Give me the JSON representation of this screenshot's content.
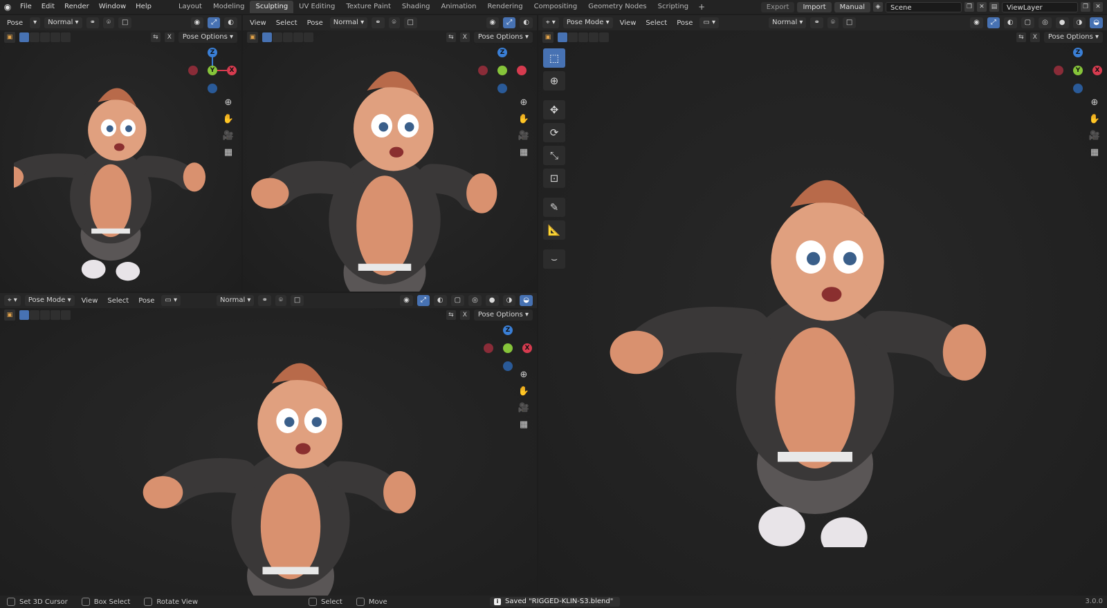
{
  "menu": [
    "File",
    "Edit",
    "Render",
    "Window",
    "Help"
  ],
  "workspaces": [
    "Layout",
    "Modeling",
    "Sculpting",
    "UV Editing",
    "Texture Paint",
    "Shading",
    "Animation",
    "Rendering",
    "Compositing",
    "Geometry Nodes",
    "Scripting"
  ],
  "active_workspace": "Sculpting",
  "top_right": {
    "export": "Export",
    "import": "Import",
    "manual": "Manual",
    "scene": "Scene",
    "view_layer": "ViewLayer"
  },
  "vp1": {
    "mode": "Pose",
    "orientation": "Normal",
    "options": "Pose Options"
  },
  "vp2": {
    "view": "View",
    "select": "Select",
    "pose": "Pose",
    "orientation": "Normal",
    "options": "Pose Options"
  },
  "vp3": {
    "mode": "Pose Mode",
    "view": "View",
    "select": "Select",
    "pose": "Pose",
    "orientation": "Normal",
    "options": "Pose Options"
  },
  "vp4": {
    "mode": "Pose Mode",
    "view": "View",
    "select": "Select",
    "pose": "Pose",
    "orientation": "Normal",
    "options": "Pose Options"
  },
  "gizmo": {
    "x": "X",
    "y": "Y",
    "z": "Z",
    "x_color": "#d63b4f",
    "y_color": "#86c43a",
    "z_color": "#3a7fd6"
  },
  "status": {
    "set_cursor": "Set 3D Cursor",
    "box_select": "Box Select",
    "rotate_view": "Rotate View",
    "select": "Select",
    "move": "Move",
    "saved_message": "Saved \"RIGGED-KLIN-S3.blend\"",
    "version": "3.0.0"
  },
  "colors": {
    "accent": "#4772b3",
    "background": "#1e1e1e",
    "skin": "#d9916f",
    "jacket": "#3a3838",
    "hair": "#b86a4a"
  }
}
